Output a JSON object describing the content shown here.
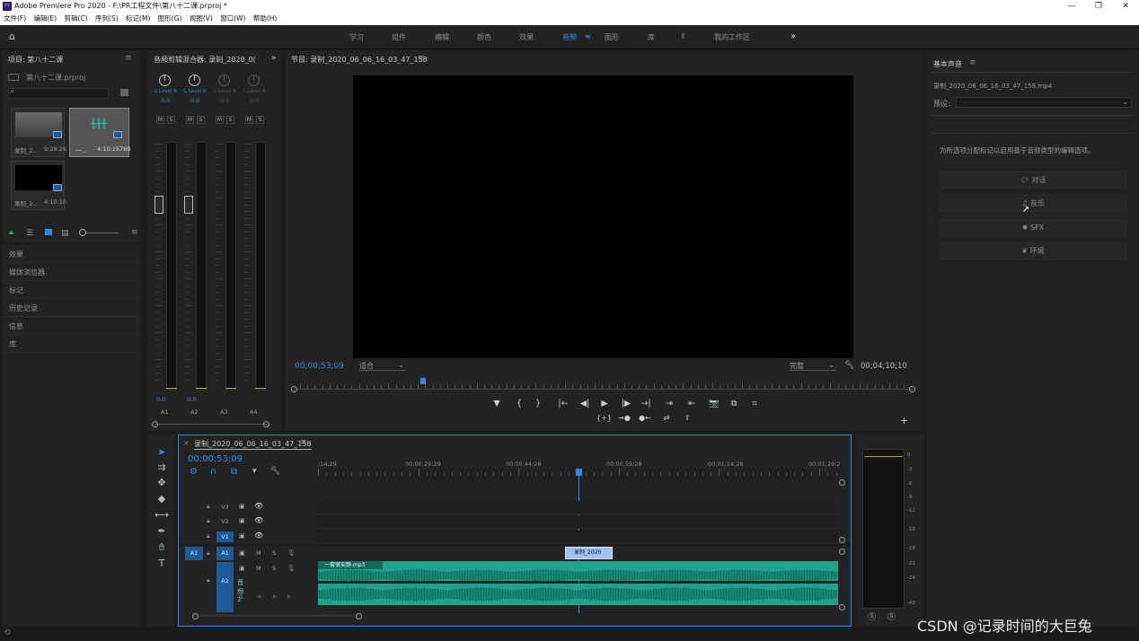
{
  "window": {
    "title": "Adobe Premiere Pro 2020 - F:\\PR工程文件\\第八十二课.prproj *",
    "app_icon": "Pr",
    "controls": [
      "—",
      "❐",
      "✕"
    ]
  },
  "menu": [
    "文件(F)",
    "编辑(E)",
    "剪辑(C)",
    "序列(S)",
    "标记(M)",
    "图形(G)",
    "视图(V)",
    "窗口(W)",
    "帮助(H)"
  ],
  "workspaces": {
    "items": [
      "学习",
      "组件",
      "编辑",
      "颜色",
      "效果",
      "音频",
      "图形",
      "库",
      "»"
    ],
    "active": "音频",
    "right": "我的工作区"
  },
  "project": {
    "title": "项目: 第八十二课",
    "file": "第八十二课.prproj",
    "clips": [
      {
        "name": "录制_2...",
        "dur": "9:28:26"
      },
      {
        "name": "一...",
        "dur": "4:10:15760"
      },
      {
        "name": "录制_2...",
        "dur": "4:10:10"
      }
    ]
  },
  "left_panels": [
    "效果",
    "媒体浏览器",
    "标记",
    "历史记录",
    "信息",
    "库"
  ],
  "mixer": {
    "title": "音频剪辑混合器: 录制_2020_0(",
    "tracks": [
      "A1",
      "A2",
      "A3",
      "A4"
    ],
    "lr": "L Level R",
    "vals": [
      "0.0",
      "0.0",
      "0.0",
      "0.0"
    ],
    "ms": [
      "M",
      "S"
    ],
    "bottom": [
      "0.0",
      "0.0"
    ]
  },
  "program": {
    "title": "节目: 录制_2020_06_06_16_03_47_158",
    "timecode": "00;00;53;09",
    "fit": "适合",
    "quality": "完整",
    "duration": "00;04;10;10"
  },
  "transport_row1": [
    "▼",
    "{",
    "}",
    "|←",
    "◀|",
    "▶",
    "|▶",
    "→|",
    "⇥",
    "⇤",
    "📷",
    "⧉",
    "⌗"
  ],
  "transport_row2": [
    "{+}",
    "→●",
    "●←",
    "⇄",
    "⇪"
  ],
  "timeline": {
    "tab": "录制_2020_06_06_16_03_47_158",
    "timecode": "00;00;53;09",
    "ticks": [
      ";14;29",
      "00;00;29;29",
      "00;00;44;28",
      "00;00;59;28",
      "00;01;14;29",
      "00;01;29;2"
    ],
    "video_tracks": [
      "V3",
      "V2",
      "V1"
    ],
    "audio_tracks": [
      "A1",
      "A2"
    ],
    "sub_label": "音频 2",
    "clip_label": "一套很安静.mp3",
    "playhead_label": "录制_2020",
    "vol": "0."
  },
  "meters": {
    "scale": [
      "0",
      "-3",
      "-6",
      "-9",
      "-12",
      "-15",
      "-18",
      "-21",
      "-24",
      "-48"
    ],
    "solo": [
      "S",
      "S"
    ]
  },
  "essential": {
    "title": "基本声音",
    "file": "录制_2020_06_06_16_03_47_158.mp4",
    "preset_label": "预设:",
    "description": "为所选项分配标记以启用基于音频类型的编辑选项。",
    "buttons": [
      "对话",
      "音乐",
      "SFX",
      "环境"
    ]
  },
  "watermark": "CSDN @记录时间的大巨兔"
}
